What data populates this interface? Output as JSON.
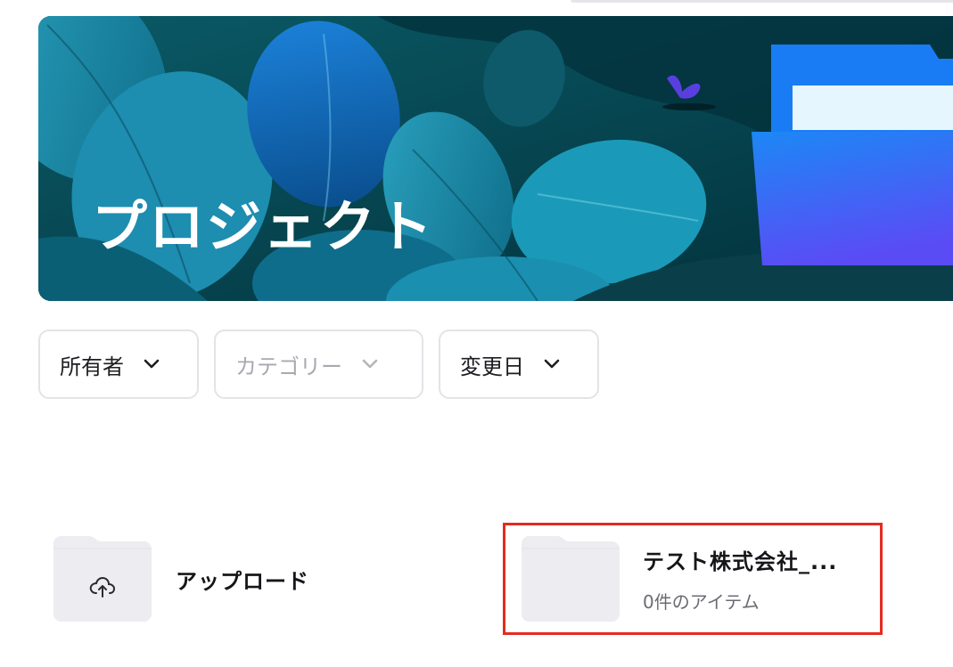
{
  "hero": {
    "title": "プロジェクト"
  },
  "filters": {
    "owner": "所有者",
    "category": "カテゴリー",
    "modified": "変更日"
  },
  "upload": {
    "label": "アップロード",
    "icon": "cloud-upload-icon"
  },
  "folder": {
    "name": "テスト株式会社_...",
    "meta": "0件のアイテム",
    "icon": "folder-icon"
  },
  "colors": {
    "hero_bg": "#063a44",
    "folder_blue": "#1a7cf5",
    "folder_grey": "#ececf1",
    "highlight": "#e62a1f"
  }
}
